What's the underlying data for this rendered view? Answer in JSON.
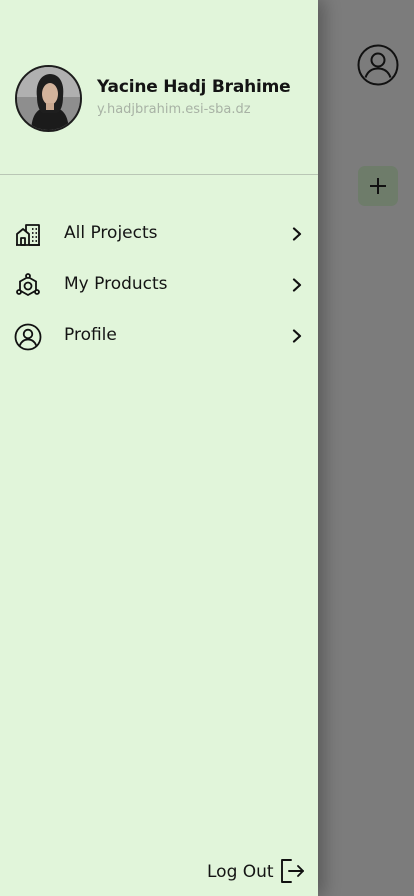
{
  "background": {
    "profile_icon": "user-circle-icon",
    "add_icon": "plus-icon"
  },
  "user": {
    "name": "Yacine Hadj Brahime",
    "email": "y.hadjbrahim.esi-sba.dz"
  },
  "menu": {
    "items": [
      {
        "label": "All Projects",
        "icon": "buildings-icon"
      },
      {
        "label": "My Products",
        "icon": "hexagon-nodes-icon"
      },
      {
        "label": "Profile",
        "icon": "user-circle-icon"
      }
    ]
  },
  "logout": {
    "label": "Log Out",
    "icon": "logout-icon"
  },
  "colors": {
    "drawer_bg": "#e1f5da",
    "scrim": "#7c7c7c",
    "text": "#141414",
    "muted": "#a8b2a5"
  }
}
